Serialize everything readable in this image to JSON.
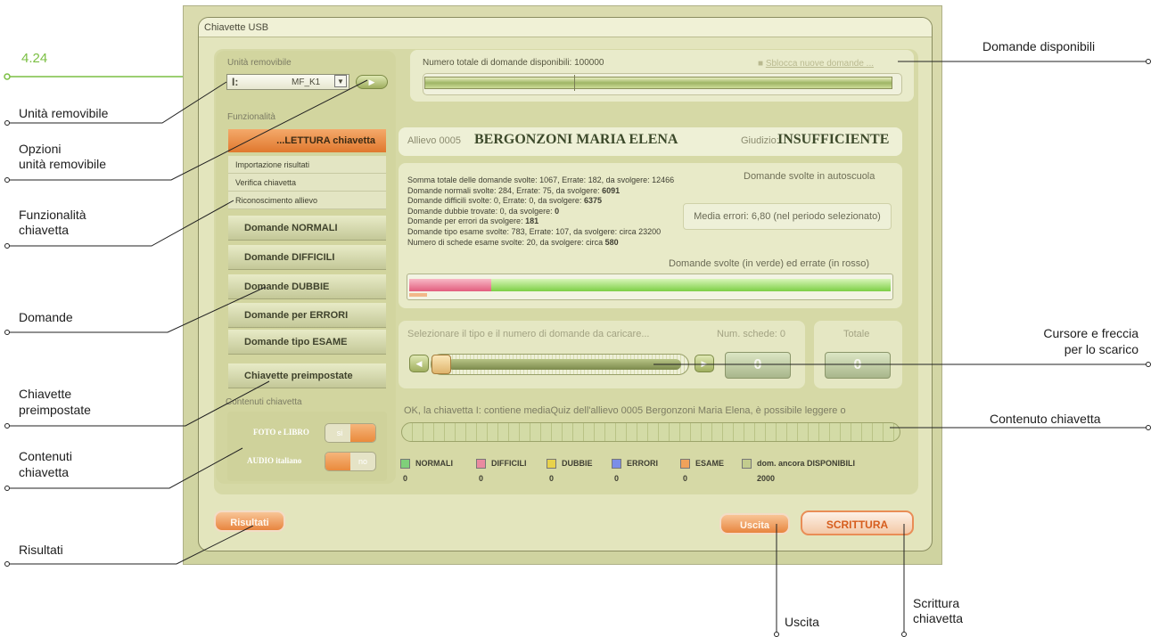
{
  "window": {
    "title": "Chiavette USB"
  },
  "unit": {
    "label": "Unità removibile",
    "drive": "I:",
    "name": "MF_K1",
    "dropdown_icon": "chevron-down-icon",
    "options_icon": "play-icon"
  },
  "functions": {
    "label": "Funzionalità",
    "active_item": "...LETTURA chiavetta",
    "sub_items": [
      "Importazione risultati",
      "Verifica chiavetta",
      "Riconoscimento allievo"
    ],
    "buttons": [
      "Domande NORMALI",
      "Domande DIFFICILI",
      "Domande DUBBIE",
      "Domande per ERRORI",
      "Domande tipo ESAME"
    ],
    "preset": "Chiavette preimpostate"
  },
  "contents": {
    "label": "Contenuti chiavetta",
    "foto_label": "FOTO e LIBRO",
    "foto_value": "si",
    "audio_label": "AUDIO italiano",
    "audio_value": "no"
  },
  "questions_available": {
    "label": "Numero totale di domande disponibili: 100000",
    "unlock_link": "Sblocca nuove domande ...",
    "fill_fraction": 0.99
  },
  "student": {
    "prefix": "Allievo 0005",
    "name": "BERGONZONI MARIA ELENA",
    "judgement_label": "Giudizio:",
    "judgement": "INSUFFICIENTE"
  },
  "stats": {
    "title": "Domande svolte in autoscuola",
    "lines": [
      {
        "text": "Somma totale delle domande svolte: 1067, Errate: 182, da svolgere: 12466",
        "bold": ""
      },
      {
        "text": "Domande normali svolte: 284, Errate: 75, da svolgere: ",
        "bold": "6091"
      },
      {
        "text": "Domande difficili svolte: 0, Errate: 0, da svolgere: ",
        "bold": "6375"
      },
      {
        "text": "Domande dubbie trovate: 0, da svolgere: ",
        "bold": "0"
      },
      {
        "text": "Domande per errori da svolgere: ",
        "bold": "181"
      },
      {
        "text": "Domande tipo esame svolte: 783, Errate: 107, da svolgere: circa 23200",
        "bold": ""
      },
      {
        "text": "Numero di schede esame svolte: 20, da svolgere: circa ",
        "bold": "580"
      }
    ],
    "media_errori": "Media errori: 6,80 (nel periodo selezionato)",
    "bar_label": "Domande svolte (in verde) ed errate (in rosso)",
    "red_fraction": 0.17,
    "green_fraction": 0.83
  },
  "download": {
    "label": "Selezionare il tipo e il numero di domande da caricare...",
    "schede_label": "Num. schede: 0",
    "value": "0",
    "totale_label": "Totale",
    "totale_value": "0",
    "left_arrow_icon": "arrow-left-icon",
    "right_arrow_icon": "arrow-right-icon"
  },
  "status": {
    "message": "OK, la chiavetta I: contiene mediaQuiz dell'allievo 0005 Bergonzoni Maria Elena, è possibile leggere o"
  },
  "legend": [
    {
      "label": "NORMALI",
      "value": "0",
      "color": "#7fd07a"
    },
    {
      "label": "DIFFICILI",
      "value": "0",
      "color": "#e98aa0"
    },
    {
      "label": "DUBBIE",
      "value": "0",
      "color": "#e8d24b"
    },
    {
      "label": "ERRORI",
      "value": "0",
      "color": "#7b8ee8"
    },
    {
      "label": "ESAME",
      "value": "0",
      "color": "#f0a25a"
    },
    {
      "label": "dom. ancora DISPONIBILI",
      "value": "2000",
      "color": "#c3cc8e"
    }
  ],
  "buttons": {
    "risultati": "Risultati",
    "uscita": "Uscita",
    "scrittura": "SCRITTURA"
  },
  "annotations": {
    "section": "4.24",
    "unita": "Unità removibile",
    "opzioni_1": "Opzioni",
    "opzioni_2": "unità removibile",
    "funz_1": "Funzionalità",
    "funz_2": "chiavetta",
    "domande": "Domande",
    "preimp_1": "Chiavette",
    "preimp_2": "preimpostate",
    "contenuti_1": "Contenuti",
    "contenuti_2": "chiavetta",
    "risultati": "Risultati",
    "disponibili": "Domande disponibili",
    "cursore_1": "Cursore e freccia",
    "cursore_2": "per lo scarico",
    "contenuto": "Contenuto chiavetta",
    "uscita": "Uscita",
    "scrittura_1": "Scrittura",
    "scrittura_2": "chiavetta"
  }
}
